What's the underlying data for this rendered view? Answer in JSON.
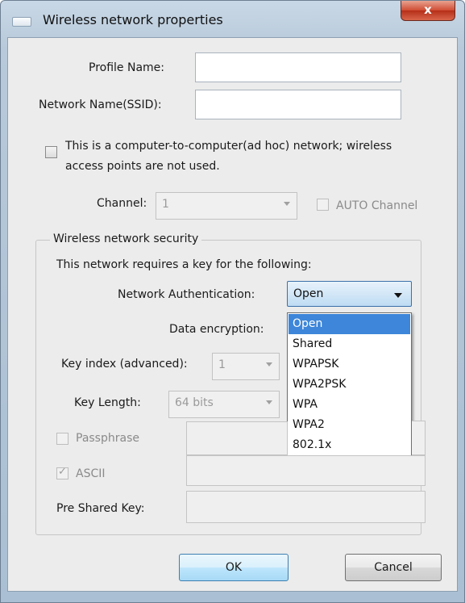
{
  "window": {
    "title": "Wireless network properties",
    "close_label": "x"
  },
  "profile": {
    "label": "Profile Name:",
    "value": ""
  },
  "ssid": {
    "label": "Network Name(SSID):",
    "value": ""
  },
  "adhoc": {
    "label_line1": "This is a computer-to-computer(ad hoc) network; wireless",
    "label_line2": "access points are not used.",
    "checked": false
  },
  "channel": {
    "label": "Channel:",
    "value": "1",
    "auto_label": "AUTO Channel"
  },
  "security": {
    "group_title": "Wireless network security",
    "requires_text": "This network requires a key for the following:",
    "auth_label": "Network Authentication:",
    "auth_value": "Open",
    "auth_options": [
      "Open",
      "Shared",
      "WPAPSK",
      "WPA2PSK",
      "WPA",
      "WPA2",
      "802.1x"
    ],
    "auth_selected_index": 0,
    "encryption_label": "Data encryption:",
    "key_index_label": "Key index (advanced):",
    "key_index_value": "1",
    "key_length_label": "Key Length:",
    "key_length_value": "64 bits",
    "passphrase_label": "Passphrase",
    "ascii_label": "ASCII",
    "ascii_checked": true,
    "psk_label": "Pre Shared Key:"
  },
  "buttons": {
    "ok": "OK",
    "cancel": "Cancel"
  },
  "colors": {
    "selection": "#3d86d9",
    "close": "#c94a33",
    "titlebar": "#b7c9da"
  }
}
